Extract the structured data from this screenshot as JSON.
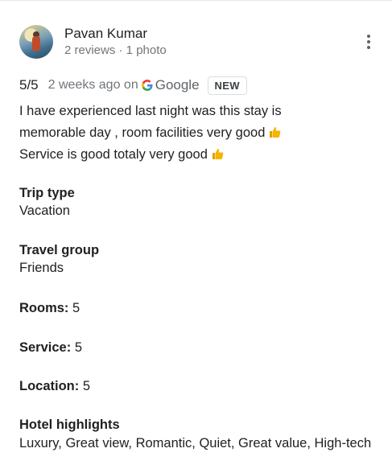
{
  "reviewer": {
    "name": "Pavan Kumar",
    "meta": "2 reviews · 1 photo"
  },
  "rating": {
    "score": "5/5",
    "when": "2 weeks ago on",
    "source": "Google",
    "badge": "NEW"
  },
  "review": {
    "line1": "I have experienced last night was this stay is",
    "line2": "memorable day , room facilities very good",
    "line3": "Service is good totaly very good"
  },
  "details": {
    "trip_type_label": "Trip type",
    "trip_type_value": "Vacation",
    "travel_group_label": "Travel group",
    "travel_group_value": "Friends",
    "rooms_label": "Rooms:",
    "rooms_value": "5",
    "service_label": "Service:",
    "service_value": "5",
    "location_label": "Location:",
    "location_value": "5",
    "highlights_label": "Hotel highlights",
    "highlights_value": "Luxury, Great view, Romantic, Quiet, Great value, High-tech"
  },
  "icons": {
    "more": "more-vert-icon",
    "google": "google-g-icon",
    "thumbs_up": "thumbs-up-emoji"
  },
  "colors": {
    "text": "#202124",
    "secondary": "#70757a",
    "emoji": "#f5b400"
  }
}
